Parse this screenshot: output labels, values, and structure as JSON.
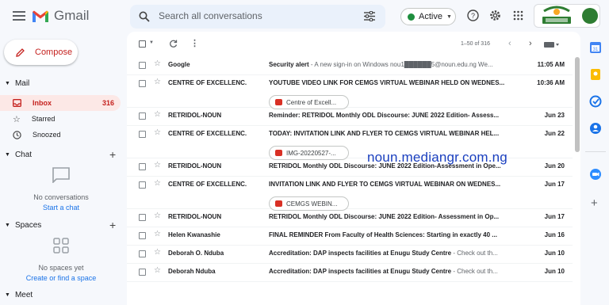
{
  "app": {
    "name": "Gmail"
  },
  "search": {
    "placeholder": "Search all conversations"
  },
  "status": {
    "label": "Active",
    "color": "#1e8e3e"
  },
  "account": {
    "logo_text": "N·OUN"
  },
  "compose": {
    "label": "Compose"
  },
  "sidebar": {
    "mail_header": "Mail",
    "items": [
      {
        "label": "Inbox",
        "count": "316",
        "icon": "inbox-icon",
        "active": true
      },
      {
        "label": "Starred",
        "count": "",
        "icon": "star-icon",
        "active": false
      },
      {
        "label": "Snoozed",
        "count": "",
        "icon": "clock-icon",
        "active": false
      }
    ],
    "chat_header": "Chat",
    "chat_empty": "No conversations",
    "chat_link": "Start a chat",
    "spaces_header": "Spaces",
    "spaces_empty": "No spaces yet",
    "spaces_link": "Create or find a space",
    "meet_header": "Meet"
  },
  "toolbar": {
    "pagination": "1–50 of 316"
  },
  "emails": [
    {
      "sender": "Google",
      "subject": "Security alert",
      "snippet": " - A new sign-in on Windows nou1██████5@noun.edu.ng We...",
      "date": "11:05 AM",
      "attachment": ""
    },
    {
      "sender": "CENTRE OF EXCELLENC.",
      "subject": "YOUTUBE VIDEO LINK FOR CEMGS VIRTUAL WEBINAR HELD ON WEDNES...",
      "snippet": "",
      "date": "10:36 AM",
      "attachment": "Centre of Excell..."
    },
    {
      "sender": "RETRIDOL-NOUN",
      "subject": "Reminder: RETRIDOL Monthly ODL Discourse: JUNE 2022 Edition- Assess...",
      "snippet": "",
      "date": "Jun 23",
      "attachment": ""
    },
    {
      "sender": "CENTRE OF EXCELLENC.",
      "subject": "TODAY: INVITATION LINK AND FLYER TO CEMGS VIRTUAL WEBINAR HEL...",
      "snippet": "",
      "date": "Jun 22",
      "attachment": "IMG-20220527-..."
    },
    {
      "sender": "RETRIDOL-NOUN",
      "subject": "RETRIDOL Monthly ODL Discourse: JUNE 2022 Edition-Assessment in Ope...",
      "snippet": "",
      "date": "Jun 20",
      "attachment": ""
    },
    {
      "sender": "CENTRE OF EXCELLENC.",
      "subject": "INVITATION LINK AND FLYER TO CEMGS VIRTUAL WEBINAR ON WEDNES...",
      "snippet": "",
      "date": "Jun 17",
      "attachment": "CEMGS WEBIN..."
    },
    {
      "sender": "RETRIDOL-NOUN",
      "subject": "RETRIDOL Monthly ODL Discourse: JUNE 2022 Edition- Assessment in Op...",
      "snippet": "",
      "date": "Jun 17",
      "attachment": ""
    },
    {
      "sender": "Helen Kwanashie",
      "subject": "FINAL REMINDER From Faculty of Health Sciences: Starting in exactly 40 ...",
      "snippet": "",
      "date": "Jun 16",
      "attachment": ""
    },
    {
      "sender": "Deborah O. Nduba",
      "subject": "Accreditation: DAP inspects facilities at Enugu Study Centre",
      "snippet": " - Check out th...",
      "date": "Jun 10",
      "attachment": ""
    },
    {
      "sender": "Deborah Nduba",
      "subject": "Accreditation: DAP inspects facilities at Enugu Study Centre",
      "snippet": " - Check out th...",
      "date": "Jun 10",
      "attachment": ""
    }
  ],
  "watermark": "noun.mediangr.com.ng"
}
